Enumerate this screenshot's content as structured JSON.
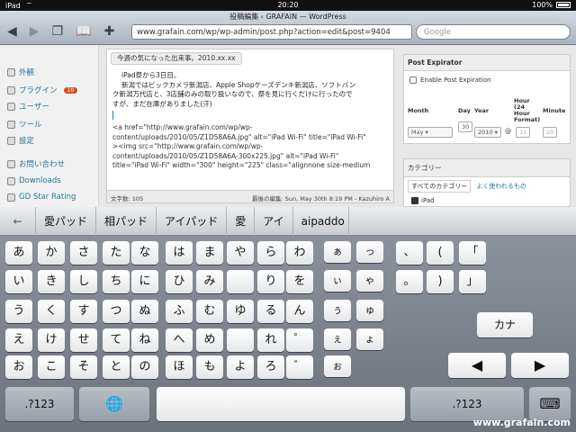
{
  "status": {
    "time": "20:20",
    "device": "iPad",
    "battery": "100%"
  },
  "browser": {
    "page_title": "投稿編集 ‹ GRAFAIN — WordPress",
    "url": "www.grafain.com/wp/wp-admin/post.php?action=edit&post=9404",
    "search_placeholder": "Google"
  },
  "sidebar": {
    "items": [
      {
        "label": "外観",
        "icon": "appearance-icon"
      },
      {
        "label": "プラグイン",
        "icon": "plugin-icon",
        "badge": "10"
      },
      {
        "label": "ユーザー",
        "icon": "users-icon"
      },
      {
        "label": "ツール",
        "icon": "tools-icon"
      },
      {
        "label": "設定",
        "icon": "settings-icon"
      },
      {
        "label": "お問い合わせ",
        "icon": "contact-icon"
      },
      {
        "label": "Downloads",
        "icon": "downloads-icon"
      },
      {
        "label": "GD Star Rating",
        "icon": "star-icon"
      }
    ]
  },
  "editor": {
    "format_button": "今週の気になった出来事。2010.xx.xx",
    "lines": [
      "iPad祭から3日目。",
      "新潟ではビックカメラ新潟店、Apple Shopケーズデンキ新潟店、ソフトバン",
      "ク新潟万代店と、3店舗のみの取り扱いなので、祭を見に行くだけに行ったので",
      "すが、まだ在庫がありました(汗)",
      "<a href=\"http://www.grafain.com/wp/wp-",
      "content/uploads/2010/05/Z1D58A6A.jpg\" alt=\"iPad Wi-Fi\" title=\"iPad Wi-Fi\"",
      "><img src=\"http://www.grafain.com/wp/wp-",
      "content/uploads/2010/05/Z1D58A6A-300x225.jpg\" alt=\"iPad Wi-Fi\"",
      "title=\"iPad Wi-Fi\" width=\"300\" height=\"225\" class=\"alignnone size-medium"
    ],
    "word_count": "文字数: 105",
    "last_edit": "最後の編集: Sun, May 30th 8:19 PM - Kazuhiro A"
  },
  "expirator": {
    "title": "Post Expirator",
    "checkbox_label": "Enable Post Expiration",
    "col_month": "Month",
    "col_day": "Day",
    "col_year": "Year",
    "col_hour": "Hour (24 Hour Format)",
    "col_minute": "Minute",
    "month": "May",
    "day": "30",
    "year": "2010",
    "at": "@",
    "hour": "11",
    "minute": "20"
  },
  "categories": {
    "title": "カテゴリー",
    "tab_all": "すべてのカテゴリー",
    "tab_popular": "よく使われるもの",
    "item": "iPad"
  },
  "keyboard": {
    "candidates": [
      "←",
      "愛パッド",
      "相パッド",
      "アイパッド",
      "愛",
      "アイ",
      "aipaddo"
    ],
    "kana": "カナ",
    "num": ".?123",
    "globe": "🌐",
    "left": "◀",
    "right": "▶",
    "hide": "⌨",
    "watermark": "www.grafain.com"
  }
}
